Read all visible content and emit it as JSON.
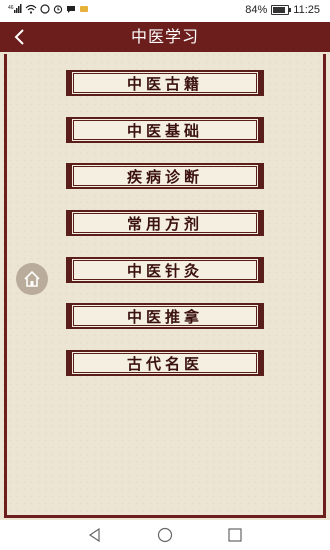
{
  "status_bar": {
    "signal_label": "46",
    "battery_text": "84%",
    "battery_level": 0.84,
    "time": "11:25",
    "icons": [
      "signal-icon",
      "wifi-icon",
      "notification-icon",
      "alarm-icon",
      "message-icon",
      "vibrate-icon",
      "battery-icon"
    ]
  },
  "header": {
    "title": "中医学习",
    "background": "#6b1e1b",
    "back_icon": "chevron-left-icon"
  },
  "menu": {
    "items": [
      {
        "label": "中医古籍"
      },
      {
        "label": "中医基础"
      },
      {
        "label": "疾病诊断"
      },
      {
        "label": "常用方剂"
      },
      {
        "label": "中医针灸"
      },
      {
        "label": "中医推拿"
      },
      {
        "label": "古代名医"
      }
    ]
  },
  "floating": {
    "home_icon": "home-icon"
  },
  "nav_bar": {
    "icons": [
      "back-triangle-icon",
      "home-circle-icon",
      "recents-square-icon"
    ]
  },
  "colors": {
    "accent": "#6b1e1b",
    "paper": "#ece5d4",
    "button_bg": "#f5efe1"
  }
}
